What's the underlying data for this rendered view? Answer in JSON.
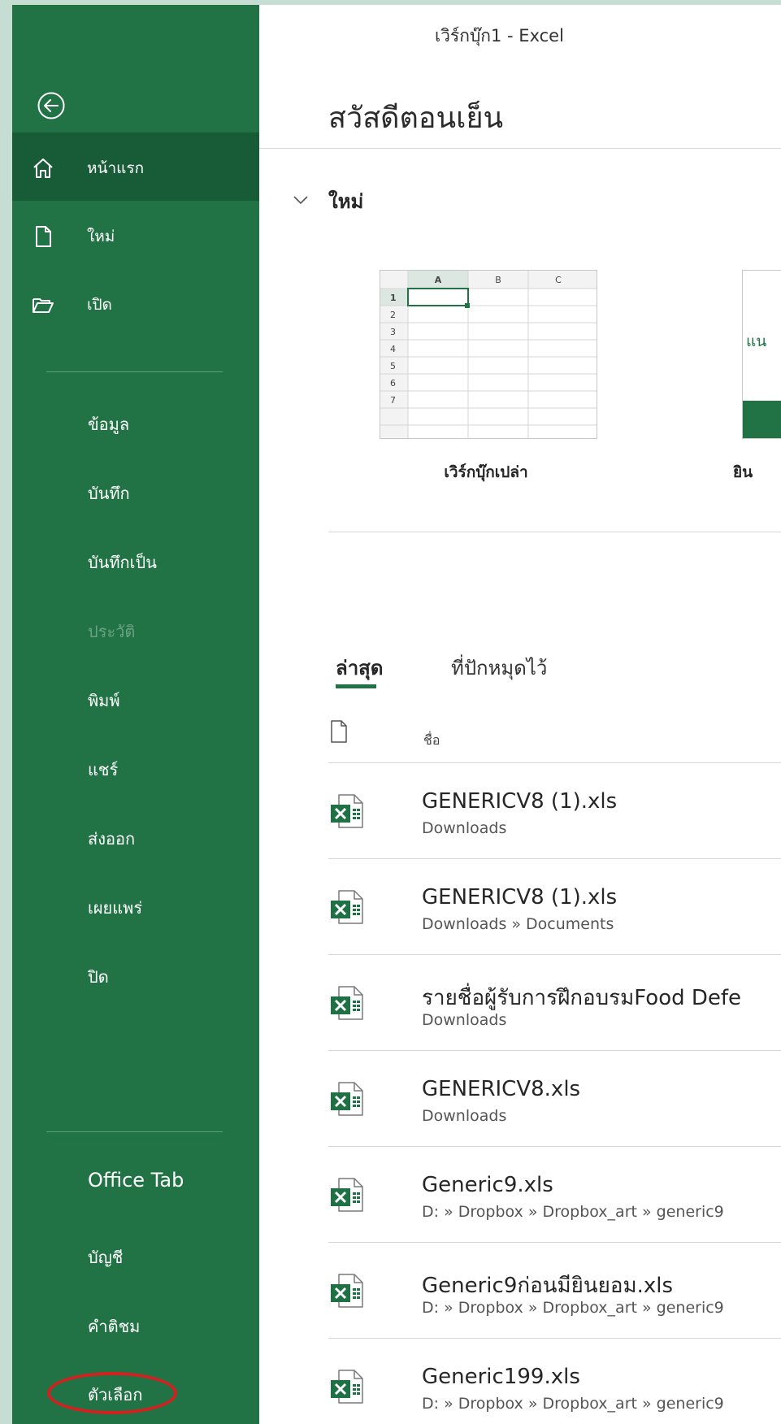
{
  "window": {
    "title": "เวิร์กบุ๊ก1  -  Excel"
  },
  "sidebar": {
    "back_icon": "back-arrow-icon",
    "nav": [
      {
        "label": "หน้าแรก",
        "icon": "home-icon",
        "selected": true
      },
      {
        "label": "ใหม่",
        "icon": "new-file-icon",
        "selected": false
      },
      {
        "label": "เปิด",
        "icon": "open-folder-icon",
        "selected": false
      }
    ],
    "menu": [
      {
        "label": "ข้อมูล",
        "enabled": true
      },
      {
        "label": "บันทึก",
        "enabled": true
      },
      {
        "label": "บันทึกเป็น",
        "enabled": true
      },
      {
        "label": "ประวัติ",
        "enabled": false
      },
      {
        "label": "พิมพ์",
        "enabled": true
      },
      {
        "label": "แชร์",
        "enabled": true
      },
      {
        "label": "ส่งออก",
        "enabled": true
      },
      {
        "label": "เผยแพร่",
        "enabled": true
      },
      {
        "label": "ปิด",
        "enabled": true
      }
    ],
    "bottom": [
      {
        "label": "Office Tab"
      },
      {
        "label": "บัญชี"
      },
      {
        "label": "คำติชม"
      },
      {
        "label": "ตัวเลือก",
        "highlighted": true
      }
    ],
    "highlight_color": "#d4201f"
  },
  "main": {
    "greeting": "สวัสดีตอนเย็น",
    "new_section": {
      "title": "ใหม่",
      "templates": [
        {
          "label": "เวิร์กบุ๊กเปล่า",
          "thumb": {
            "cols": [
              "A",
              "B",
              "C"
            ],
            "rows": [
              "1",
              "2",
              "3",
              "4",
              "5",
              "6",
              "7"
            ]
          }
        },
        {
          "label": "ยิน",
          "thumb_text": "แน"
        }
      ]
    },
    "tabs": [
      {
        "label": "ล่าสุด",
        "active": true
      },
      {
        "label": "ที่ปักหมุดไว้",
        "active": false
      }
    ],
    "list_header": {
      "name": "ชื่อ"
    },
    "files": [
      {
        "name": "GENERICV8 (1).xls",
        "path": "Downloads"
      },
      {
        "name": "GENERICV8 (1).xls",
        "path": "Downloads » Documents"
      },
      {
        "name": "รายชื่อผู้รับการฝึกอบรมFood Defe",
        "path": "Downloads"
      },
      {
        "name": "GENERICV8.xls",
        "path": "Downloads"
      },
      {
        "name": "Generic9.xls",
        "path": "D: » Dropbox » Dropbox_art » generic9"
      },
      {
        "name": "Generic9ก่อนมียินยอม.xls",
        "path": "D: » Dropbox » Dropbox_art » generic9"
      },
      {
        "name": "Generic199.xls",
        "path": "D: » Dropbox » Dropbox_art » generic9"
      }
    ]
  },
  "colors": {
    "brand_green": "#217346",
    "selected_green": "#185c37",
    "disabled_text": "#6aa383",
    "outer_background": "#c5ddd3"
  }
}
